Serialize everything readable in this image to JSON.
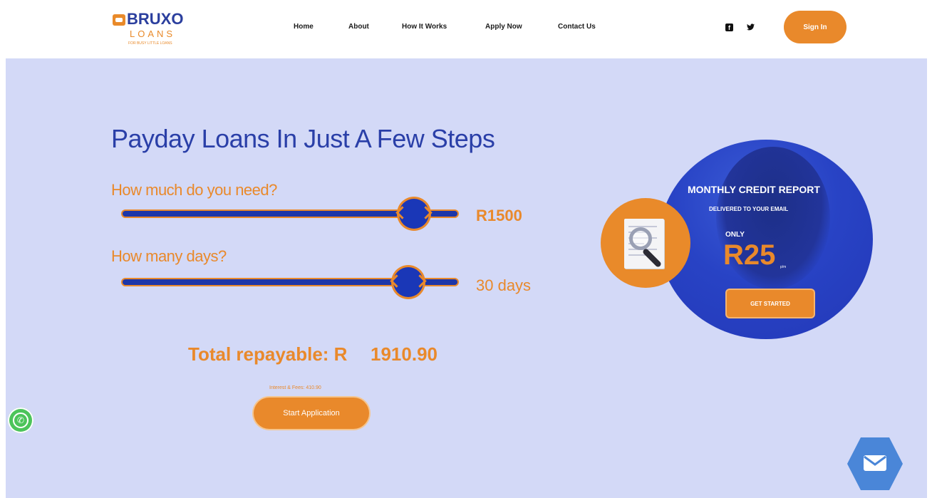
{
  "brand": {
    "name_top": "BRUXO",
    "name_bottom": "LOANS",
    "tagline": "FOR BUSY LITTLE LOANS"
  },
  "nav": {
    "items": [
      {
        "label": "Home"
      },
      {
        "label": "About"
      },
      {
        "label": "How It Works"
      },
      {
        "label": "Apply Now"
      },
      {
        "label": "Contact Us"
      }
    ],
    "facebook_icon": "f",
    "twitter_icon": "❧",
    "signin_label": "Sign In"
  },
  "hero": {
    "title": "Payday Loans In Just A Few Steps",
    "amount_question": "How much do you need?",
    "amount_value": "R1500",
    "amount_fraction": 0.92,
    "days_question": "How many days?",
    "days_value": "30 days",
    "days_fraction": 0.92,
    "total_label": "Total repayable: R",
    "total_amount": "1910.90",
    "fees_text": "Interest & Fees: 410.90",
    "start_button": "Start Application"
  },
  "promo": {
    "title": "MONTHLY CREDIT REPORT",
    "subtitle": "DELIVERED TO YOUR EMAIL",
    "only": "ONLY",
    "price": "R25",
    "unit": "p/m",
    "button": "GET STARTED"
  },
  "floating": {
    "whatsapp_glyph": "✆"
  },
  "colors": {
    "accent": "#e9892b",
    "primary": "#2a3fa8",
    "hero_bg": "#d3d9f7"
  }
}
